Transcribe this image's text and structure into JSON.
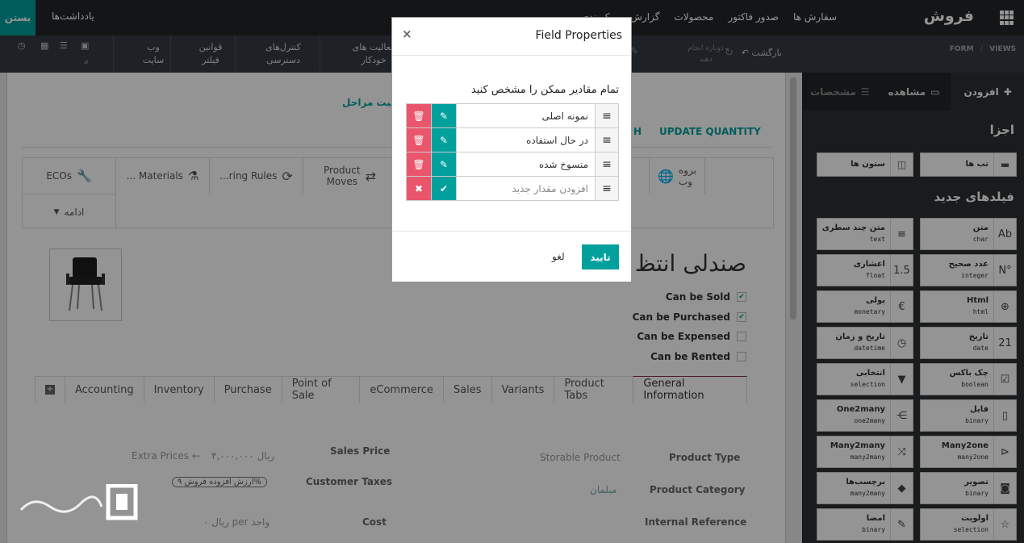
{
  "topbar": {
    "close_label": "بستن",
    "notes_label": "یادداشت‌ها",
    "brand": "فروش",
    "menu": [
      "سفارش ها",
      "صدور فاکتور",
      "محصولات",
      "گزارش",
      "پیکربندی"
    ]
  },
  "secbar": {
    "breadcrumb_views": "VIEWS",
    "breadcrumb_form": "FORM",
    "back_label": "بازگشت",
    "redo_label": "دوباره انجام\nدهید",
    "studio_items": [
      "فعالیت های\nخودکار",
      "کنترل‌های\nدسترسی",
      "قوانین\nفیلتر",
      "وب\nسایت"
    ]
  },
  "form": {
    "status_label": "عیت مراحل",
    "header_buttons": [
      "UPDATE QUANTITY",
      "H"
    ],
    "smart_buttons": [
      "Product\nMoves",
      "...ring Rules",
      "... Materials",
      "ECOs",
      "بروه\nوب"
    ],
    "more_label": "ادامه",
    "title": "صندلی انتظ",
    "checkboxes": [
      {
        "label": "Can be Sold",
        "checked": true
      },
      {
        "label": "Can be Purchased",
        "checked": true
      },
      {
        "label": "Can be Expensed",
        "checked": false
      },
      {
        "label": "Can be Rented",
        "checked": false
      }
    ],
    "tabs": [
      "General Information",
      "Product Tabs",
      "Variants",
      "Sales",
      "eCommerce",
      "Point of Sale",
      "Purchase",
      "Inventory",
      "Accounting"
    ],
    "fields": {
      "product_type_label": "Product Type",
      "product_type_value": "Storable Product",
      "product_category_label": "Product Category",
      "product_category_value": "مبلمان",
      "internal_ref_label": "Internal Reference",
      "sales_price_label": "Sales Price",
      "sales_price_value": "۴,۰۰۰,۰۰۰ ریال",
      "extra_prices": "Extra Prices",
      "customer_taxes_label": "Customer Taxes",
      "customer_taxes_value": "ارزش افزوده فروش ۹%",
      "cost_label": "Cost",
      "cost_value": "۰ ریال per واحد"
    }
  },
  "panel": {
    "tabs": [
      "افزودن",
      "مشاهده",
      "مشخصات"
    ],
    "components_heading": "اجزا",
    "components": [
      {
        "label": "تب ها",
        "icon": "tabs-icon"
      },
      {
        "label": "ستون ها",
        "icon": "columns-icon"
      }
    ],
    "new_fields_heading": "فیلدهای جدید",
    "fields": [
      {
        "label": "متن",
        "type": "char",
        "glyph": "Ab"
      },
      {
        "label": "متن چند سطری",
        "type": "text",
        "glyph": "≡"
      },
      {
        "label": "عدد صحیح",
        "type": "integer",
        "glyph": "N°"
      },
      {
        "label": "اعشاری",
        "type": "float",
        "glyph": "1.5"
      },
      {
        "label": "Html",
        "type": "html",
        "glyph": "⊕"
      },
      {
        "label": "پولی",
        "type": "monetary",
        "glyph": "€"
      },
      {
        "label": "تاریخ",
        "type": "date",
        "glyph": "21"
      },
      {
        "label": "تاریخ و زمان",
        "type": "datetime",
        "glyph": "◷"
      },
      {
        "label": "چک باکس",
        "type": "boolean",
        "glyph": "☑"
      },
      {
        "label": "انتخابی",
        "type": "selection",
        "glyph": "▼"
      },
      {
        "label": "فایل",
        "type": "binary",
        "glyph": "▯"
      },
      {
        "label": "One2many",
        "type": "one2many",
        "glyph": "⋲"
      },
      {
        "label": "Many2one",
        "type": "many2one",
        "glyph": "⊳"
      },
      {
        "label": "Many2many",
        "type": "many2many",
        "glyph": "⤨"
      },
      {
        "label": "تصویر",
        "type": "binary",
        "glyph": "◙"
      },
      {
        "label": "برچسب‌ها",
        "type": "many2many",
        "glyph": "◆"
      },
      {
        "label": "اولویت",
        "type": "selection",
        "glyph": "☆"
      },
      {
        "label": "امضا",
        "type": "binary",
        "glyph": "✎"
      }
    ]
  },
  "modal": {
    "title": "Field Properties",
    "instruction": "تمام مقادیر ممکن را مشخص کنید",
    "values": [
      "نمونه اصلی",
      "در حال استفاده",
      "منسوخ شده"
    ],
    "new_value_placeholder": "افزودن مقدار جدید",
    "confirm_label": "تایید",
    "cancel_label": "لغو"
  },
  "colors": {
    "accent": "#00a09d",
    "danger": "#e9566b",
    "dark": "#212529"
  }
}
